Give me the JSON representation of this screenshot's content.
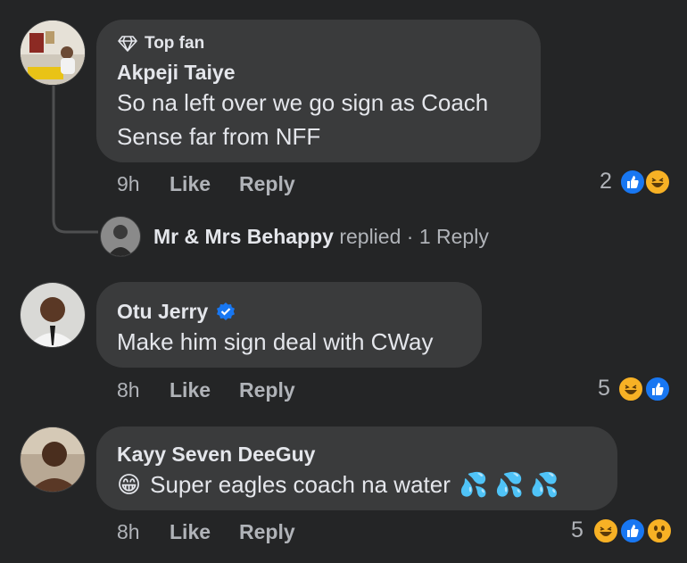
{
  "comments": [
    {
      "badge": "Top fan",
      "author": "Akpeji Taiye",
      "text_line1": "So na left over we go sign as Coach",
      "text_line2": "Sense far from NFF",
      "time": "9h",
      "like_label": "Like",
      "reply_label": "Reply",
      "reaction_count": "2",
      "reactions": [
        "like-icon",
        "haha-icon"
      ],
      "reply_thread": {
        "replier": "Mr & Mrs Behappy",
        "replied_label": "replied",
        "separator": "·",
        "reply_count_label": "1 Reply"
      }
    },
    {
      "author": "Otu Jerry",
      "verified": true,
      "text": "Make him sign deal with CWay",
      "time": "8h",
      "like_label": "Like",
      "reply_label": "Reply",
      "reaction_count": "5",
      "reactions": [
        "haha-icon",
        "like-icon"
      ]
    },
    {
      "author": "Kayy Seven DeeGuy",
      "emoji_prefix": "😁",
      "text": "Super eagles coach na water",
      "emoji_suffix": "💦 💦 💦",
      "time": "8h",
      "like_label": "Like",
      "reply_label": "Reply",
      "reaction_count": "5",
      "reactions": [
        "haha-icon",
        "like-icon",
        "wow-icon"
      ]
    }
  ],
  "colors": {
    "background": "#242526",
    "bubble": "#3a3b3c",
    "primary_text": "#e4e6eb",
    "secondary_text": "#b0b3b8",
    "like_blue": "#1877f2",
    "emoji_yellow": "#f7b125",
    "verified_blue": "#1877f2"
  }
}
